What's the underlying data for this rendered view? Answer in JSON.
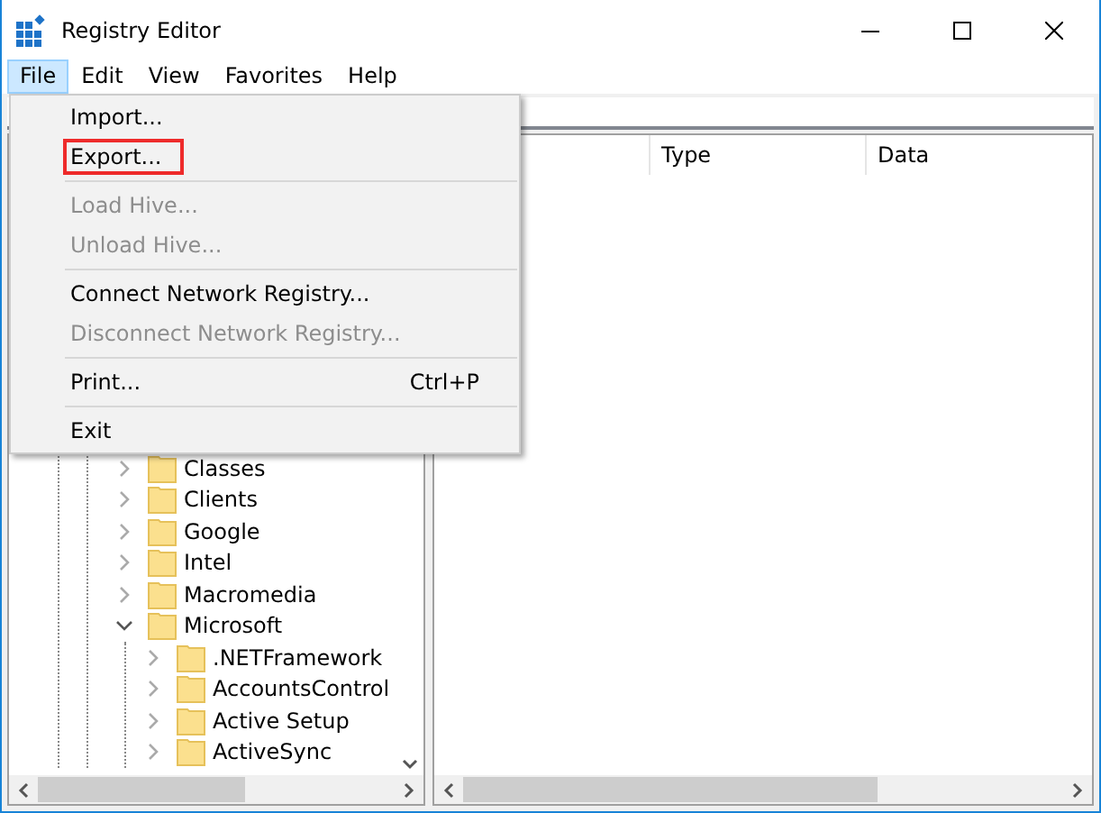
{
  "window": {
    "title": "Registry Editor"
  },
  "menu_bar": [
    {
      "label": "File",
      "selected": true
    },
    {
      "label": "Edit",
      "selected": false
    },
    {
      "label": "View",
      "selected": false
    },
    {
      "label": "Favorites",
      "selected": false
    },
    {
      "label": "Help",
      "selected": false
    }
  ],
  "file_menu": [
    {
      "kind": "item",
      "label": "Import...",
      "disabled": false,
      "marked": false
    },
    {
      "kind": "item",
      "label": "Export...",
      "disabled": false,
      "marked": true
    },
    {
      "kind": "separator"
    },
    {
      "kind": "item",
      "label": "Load Hive...",
      "disabled": true,
      "marked": false
    },
    {
      "kind": "item",
      "label": "Unload Hive...",
      "disabled": true,
      "marked": false
    },
    {
      "kind": "separator"
    },
    {
      "kind": "item",
      "label": "Connect Network Registry...",
      "disabled": false,
      "marked": false
    },
    {
      "kind": "item",
      "label": "Disconnect Network Registry...",
      "disabled": true,
      "marked": false
    },
    {
      "kind": "separator"
    },
    {
      "kind": "item",
      "label": "Print...",
      "shortcut": "Ctrl+P",
      "disabled": false,
      "marked": false
    },
    {
      "kind": "separator"
    },
    {
      "kind": "item",
      "label": "Exit",
      "disabled": false,
      "marked": false
    }
  ],
  "tree": [
    {
      "label": "Classes",
      "expanded": false
    },
    {
      "label": "Clients",
      "expanded": false
    },
    {
      "label": "Google",
      "expanded": false
    },
    {
      "label": "Intel",
      "expanded": false
    },
    {
      "label": "Macromedia",
      "expanded": false
    },
    {
      "label": "Microsoft",
      "expanded": true,
      "children": [
        {
          "label": ".NETFramework",
          "expanded": false
        },
        {
          "label": "AccountsControl",
          "expanded": false
        },
        {
          "label": "Active Setup",
          "expanded": false
        },
        {
          "label": "ActiveSync",
          "expanded": false
        }
      ]
    }
  ],
  "list": {
    "columns": [
      "Type",
      "Data"
    ]
  }
}
